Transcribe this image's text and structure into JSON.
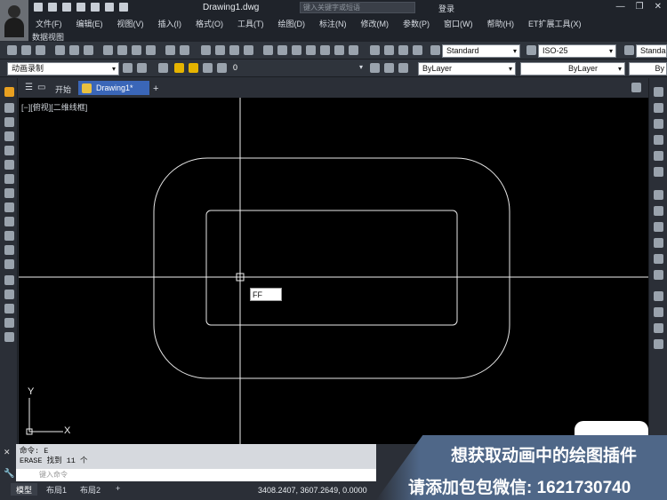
{
  "window": {
    "title": "Drawing1.dwg",
    "search_placeholder": "键入关键字或短语",
    "login": "登录"
  },
  "menu": [
    "文件(F)",
    "编辑(E)",
    "视图(V)",
    "插入(I)",
    "格式(O)",
    "工具(T)",
    "绘图(D)",
    "标注(N)",
    "修改(M)",
    "参数(P)",
    "窗口(W)",
    "帮助(H)",
    "ET扩展工具(X)"
  ],
  "menu_row2": "数据视图",
  "toolbar1": {
    "text_style": "Standard",
    "dim_style": "ISO-25",
    "table_style": "Standa"
  },
  "toolbar2": {
    "workspace": "动画录制",
    "layer": "0",
    "color": "ByLayer",
    "linetype": "ByLayer",
    "lineweight": "By"
  },
  "tabs": {
    "start": "开始",
    "drawing": "Drawing1*",
    "add": "+"
  },
  "viewport": {
    "label": "[−][俯视][二维线框]"
  },
  "dyn_input": "FF",
  "command": {
    "line1": "命令: E",
    "line2": "ERASE 找到 11 个",
    "placeholder": "键入命令"
  },
  "layouts": [
    "模型",
    "布局1",
    "布局2",
    "+"
  ],
  "coords": "3408.2407, 3607.2649, 0.0000",
  "promo": {
    "line1": "想获取动画中的绘图插件",
    "line2": "请添加包包微信: 1621730740"
  },
  "colors": {
    "canvas": "#000000",
    "accent": "#3a66b8",
    "promo": "#4f6788"
  }
}
